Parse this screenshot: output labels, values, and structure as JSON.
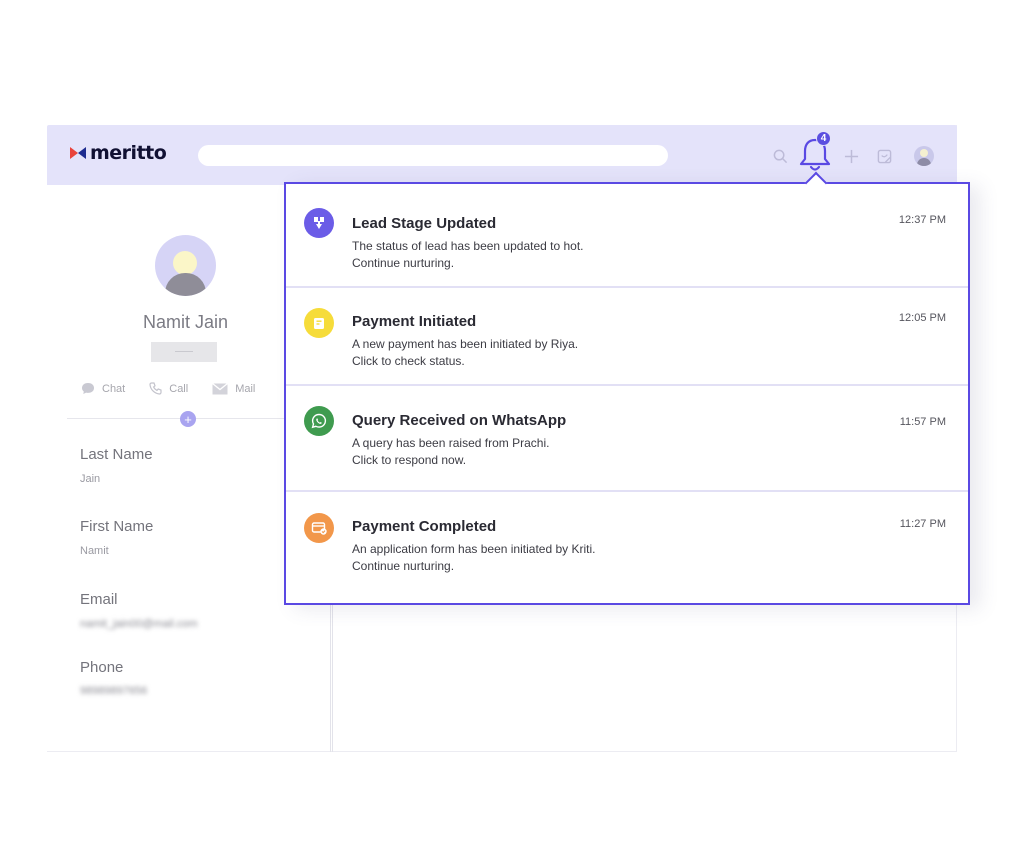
{
  "brand": {
    "name": "meritto"
  },
  "header": {
    "notification_count": "4"
  },
  "profile": {
    "name": "Namit Jain",
    "actions": [
      {
        "label": "Chat",
        "icon": "chat-icon"
      },
      {
        "label": "Call",
        "icon": "phone-icon"
      },
      {
        "label": "Mail",
        "icon": "mail-icon"
      }
    ],
    "fields": [
      {
        "label": "Last Name",
        "value": "Jain"
      },
      {
        "label": "First Name",
        "value": "Namit"
      },
      {
        "label": "Email",
        "value": "namit_jain00@mail.com"
      },
      {
        "label": "Phone",
        "value": "98989897656"
      }
    ]
  },
  "notifications": [
    {
      "title": "Lead Stage Updated",
      "body_line1": "The status of lead has been updated to hot.",
      "body_line2": "Continue nurturing.",
      "time": "12:37 PM",
      "icon": "lead-stage-icon",
      "color": "#6b5ce7"
    },
    {
      "title": "Payment Initiated",
      "body_line1": "A new payment has been initiated by Riya.",
      "body_line2": "Click to check status.",
      "time": "12:05 PM",
      "icon": "payment-icon",
      "color": "#f6dc3a"
    },
    {
      "title": "Query Received on WhatsApp",
      "body_line1": "A query has been raised from Prachi.",
      "body_line2": "Click to respond now.",
      "time": "11:57 PM",
      "icon": "whatsapp-icon",
      "color": "#3f9b4f"
    },
    {
      "title": "Payment Completed",
      "body_line1": "An application form has been initiated by Kriti.",
      "body_line2": "Continue nurturing.",
      "time": "11:27 PM",
      "icon": "card-icon",
      "color": "#f2974a"
    }
  ],
  "colors": {
    "accent": "#5a49e3",
    "header_bg": "#e4e3fa"
  }
}
